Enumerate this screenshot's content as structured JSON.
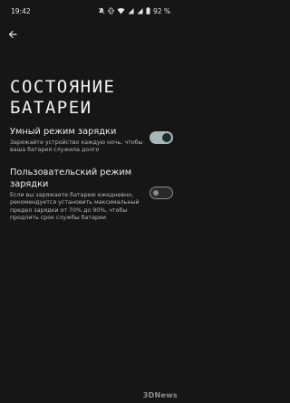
{
  "status_bar": {
    "time": "19:42",
    "battery_percent": "92 %",
    "icons": [
      "mute-icon",
      "vibrate-icon",
      "wifi-icon",
      "signal-icon",
      "signal-icon",
      "battery-icon"
    ]
  },
  "header": {
    "back_icon": "arrow-left-icon"
  },
  "page": {
    "title_line1": "СОСТОЯНИЕ",
    "title_line2": "БАТАРЕИ"
  },
  "settings": [
    {
      "title": "Умный режим зарядки",
      "description": "Заряжайте устройство каждую ночь, чтобы ваша батарея служила долго",
      "enabled": true
    },
    {
      "title": "Пользовательский режим зарядки",
      "description": "Если вы заряжаете батарею ежедневно, рекомендуется установить максимальный предел зарядки от 70% до 90%, чтобы продлить срок службы батареи",
      "enabled": false
    }
  ],
  "watermark": {
    "logo": "3DNews"
  },
  "colors": {
    "background": "#161616",
    "toggle_on": "#a9b6b8",
    "toggle_off_border": "#8a8a8a"
  }
}
